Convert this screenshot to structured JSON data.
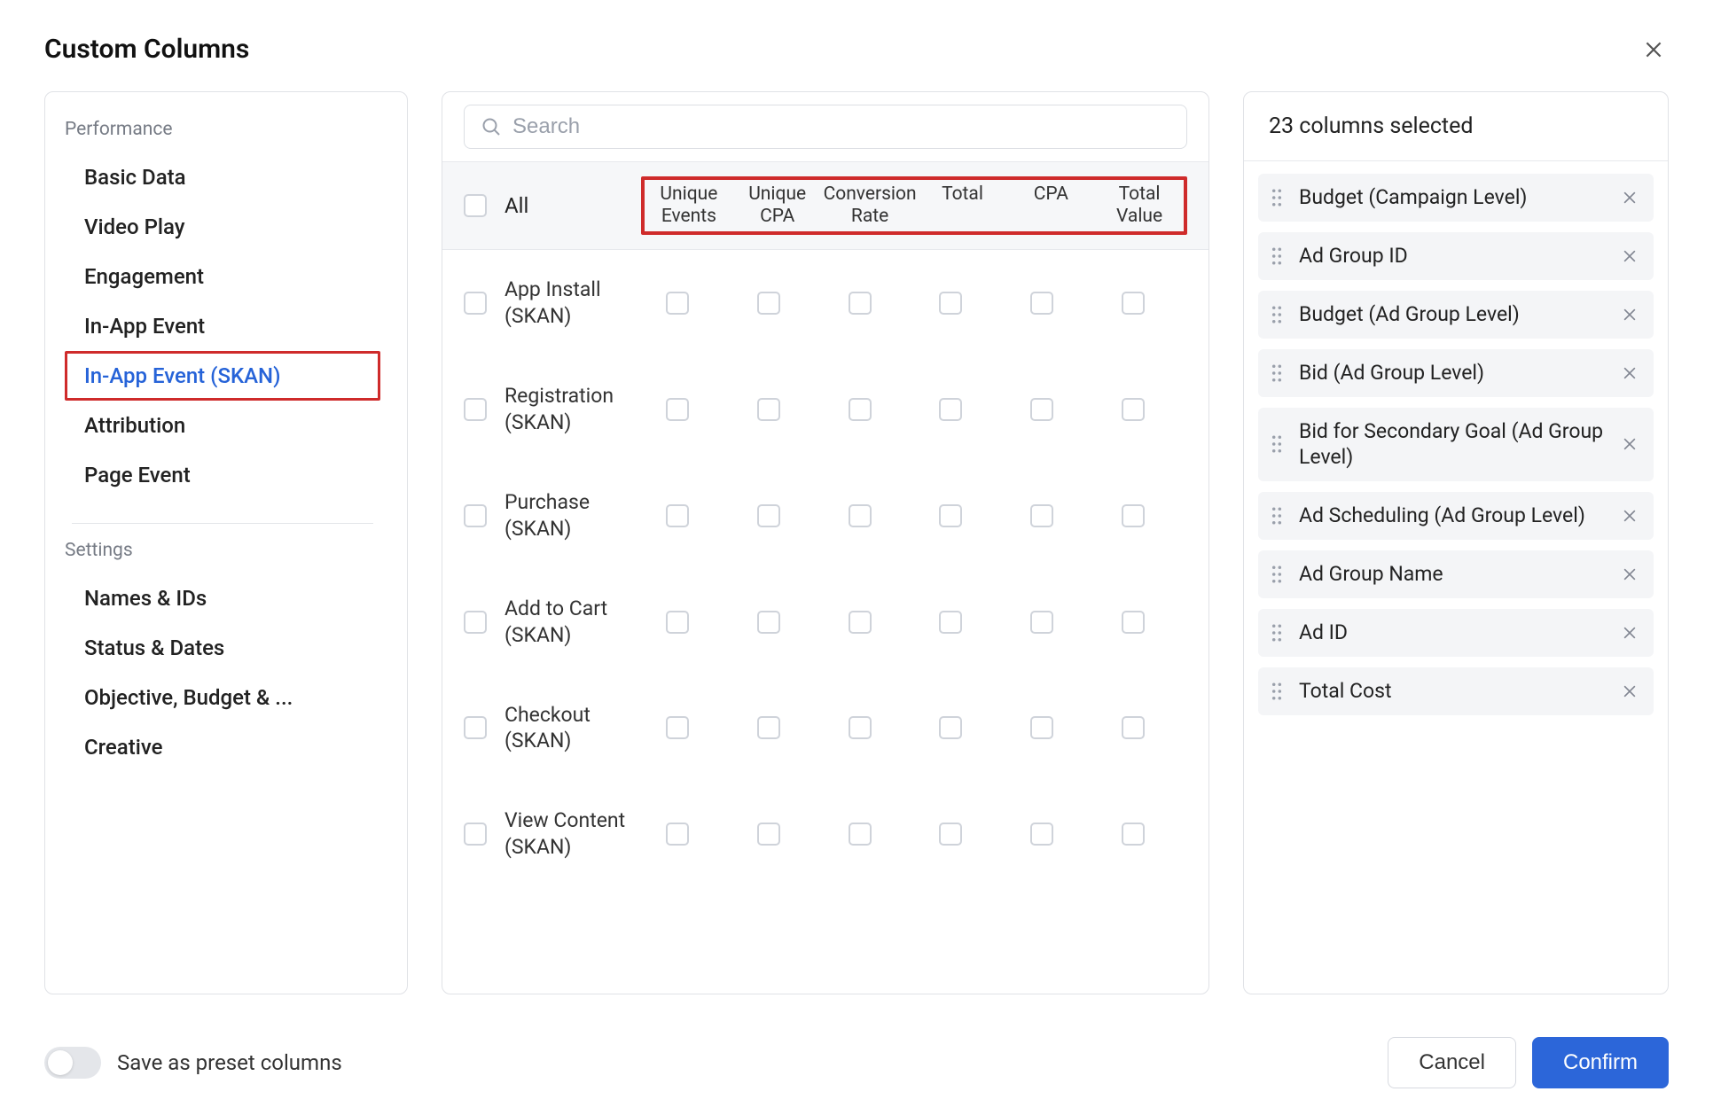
{
  "title": "Custom Columns",
  "search_placeholder": "Search",
  "sidebar": {
    "groups": [
      {
        "label": "Performance",
        "items": [
          {
            "label": "Basic Data",
            "active": false
          },
          {
            "label": "Video Play",
            "active": false
          },
          {
            "label": "Engagement",
            "active": false
          },
          {
            "label": "In-App Event",
            "active": false
          },
          {
            "label": "In-App Event (SKAN)",
            "active": true
          },
          {
            "label": "Attribution",
            "active": false
          },
          {
            "label": "Page Event",
            "active": false
          }
        ]
      },
      {
        "label": "Settings",
        "items": [
          {
            "label": "Names & IDs",
            "active": false
          },
          {
            "label": "Status & Dates",
            "active": false
          },
          {
            "label": "Objective, Budget & ...",
            "active": false
          },
          {
            "label": "Creative",
            "active": false
          }
        ]
      }
    ]
  },
  "metric_columns": {
    "all_label": "All",
    "headers": [
      "Unique Events",
      "Unique CPA",
      "Conversion Rate",
      "Total",
      "CPA",
      "Total Value"
    ]
  },
  "events": [
    {
      "name": "App Install (SKAN)"
    },
    {
      "name": "Registration (SKAN)"
    },
    {
      "name": "Purchase (SKAN)"
    },
    {
      "name": "Add to Cart (SKAN)"
    },
    {
      "name": "Checkout (SKAN)"
    },
    {
      "name": "View Content (SKAN)"
    }
  ],
  "selected": {
    "count_label": "23 columns selected",
    "items": [
      "Budget (Campaign Level)",
      "Ad Group ID",
      "Budget (Ad Group Level)",
      "Bid (Ad Group Level)",
      "Bid for Secondary Goal (Ad Group Level)",
      "Ad Scheduling (Ad Group Level)",
      "Ad Group Name",
      "Ad ID",
      "Total Cost"
    ]
  },
  "footer": {
    "preset_label": "Save as preset columns",
    "cancel": "Cancel",
    "confirm": "Confirm"
  }
}
